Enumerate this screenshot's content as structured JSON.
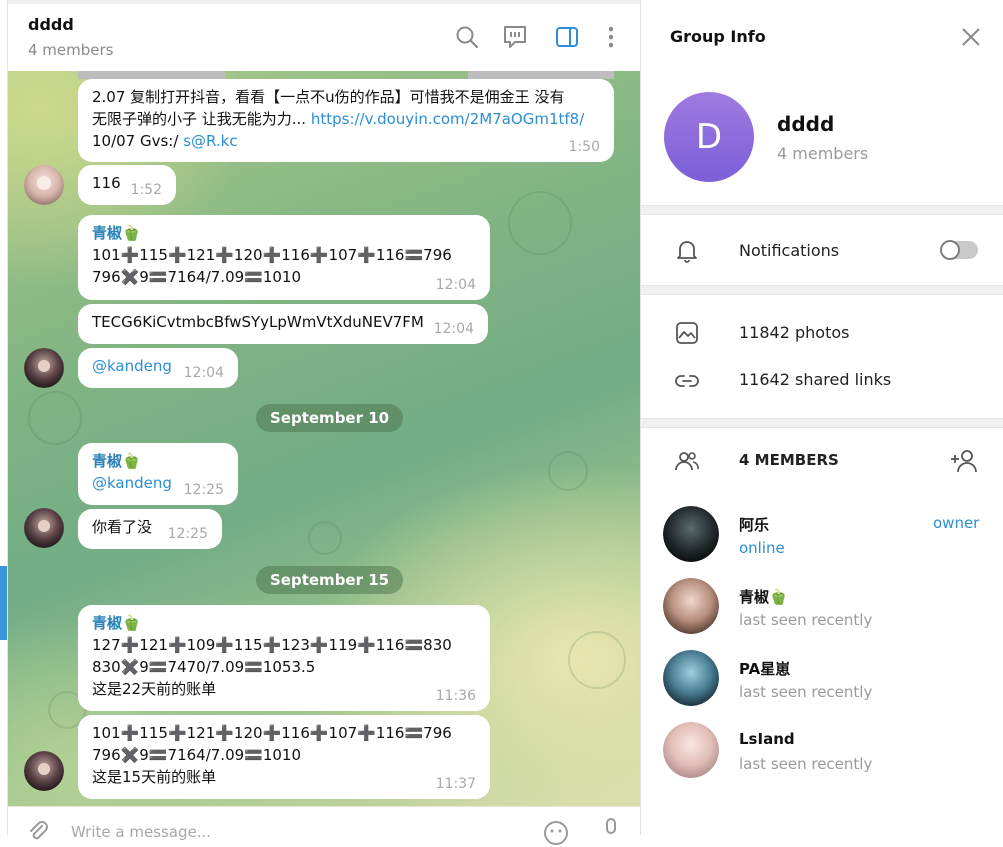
{
  "chat": {
    "title": "dddd",
    "subtitle": "4 members",
    "composer_placeholder": "Write a message...",
    "icons": [
      "search-icon",
      "topics-icon",
      "sidebar-toggle-icon",
      "more-icon",
      "attach-icon",
      "emoji-icon",
      "microphone-icon"
    ],
    "messages": [
      {
        "text1": "2.07 复制打开抖音，看看【一点不u伤的作品】可惜我不是佣金王 没有",
        "text2a": "无限子弹的小子 让我无能为力... ",
        "link1": "https://v.douyin.com/2M7aOGm1tf8/",
        "text3a": "10/07 Gvs:/ ",
        "link2": "s@R.kc",
        "time": "1:50"
      },
      {
        "text": "116",
        "time": "1:52"
      },
      {
        "sender": "青椒🫑",
        "line1": "101➕115➕121➕120➕116➕107➕116🟰796",
        "line2": "796✖️9🟰7164/7.09🟰1010",
        "time": "12:04"
      },
      {
        "text": "TECG6KiCvtmbcBfwSYyLpWmVtXduNEV7FM",
        "time": "12:04"
      },
      {
        "text": "@kandeng",
        "time": "12:04"
      },
      {
        "sender": "青椒🫑",
        "text": "@kandeng",
        "time": "12:25"
      },
      {
        "text": "你看了没",
        "time": "12:25"
      },
      {
        "sender": "青椒🫑",
        "line1": "127➕121➕109➕115➕123➕119➕116🟰830",
        "line2": "830✖️9🟰7470/7.09🟰1053.5",
        "line3": "这是22天前的账单",
        "time": "11:36"
      },
      {
        "line1": "101➕115➕121➕120➕116➕107➕116🟰796",
        "line2": "796✖️9🟰7164/7.09🟰1010",
        "line3": "这是15天前的账单",
        "time": "11:37"
      }
    ],
    "dates": [
      "September 10",
      "September 15"
    ]
  },
  "group_info": {
    "title": "Group Info",
    "avatar_letter": "D",
    "name": "dddd",
    "members_count": "4 members",
    "notifications_label": "Notifications",
    "notifications_on": false,
    "photos_label": "11842 photos",
    "links_label": "11642 shared links",
    "members_header": "4 MEMBERS",
    "members": [
      {
        "name": "阿乐",
        "status": "online",
        "role": "owner"
      },
      {
        "name": "青椒🫑",
        "status": "last seen recently",
        "role": ""
      },
      {
        "name": "PA星崽",
        "status": "last seen recently",
        "role": ""
      },
      {
        "name": "LsIand",
        "status": "last seen recently",
        "role": ""
      }
    ],
    "colors": {
      "accent": "#2b8ed6",
      "avatar_gradient_top": "#a07ae0",
      "avatar_gradient_bottom": "#7b5fd8"
    }
  }
}
